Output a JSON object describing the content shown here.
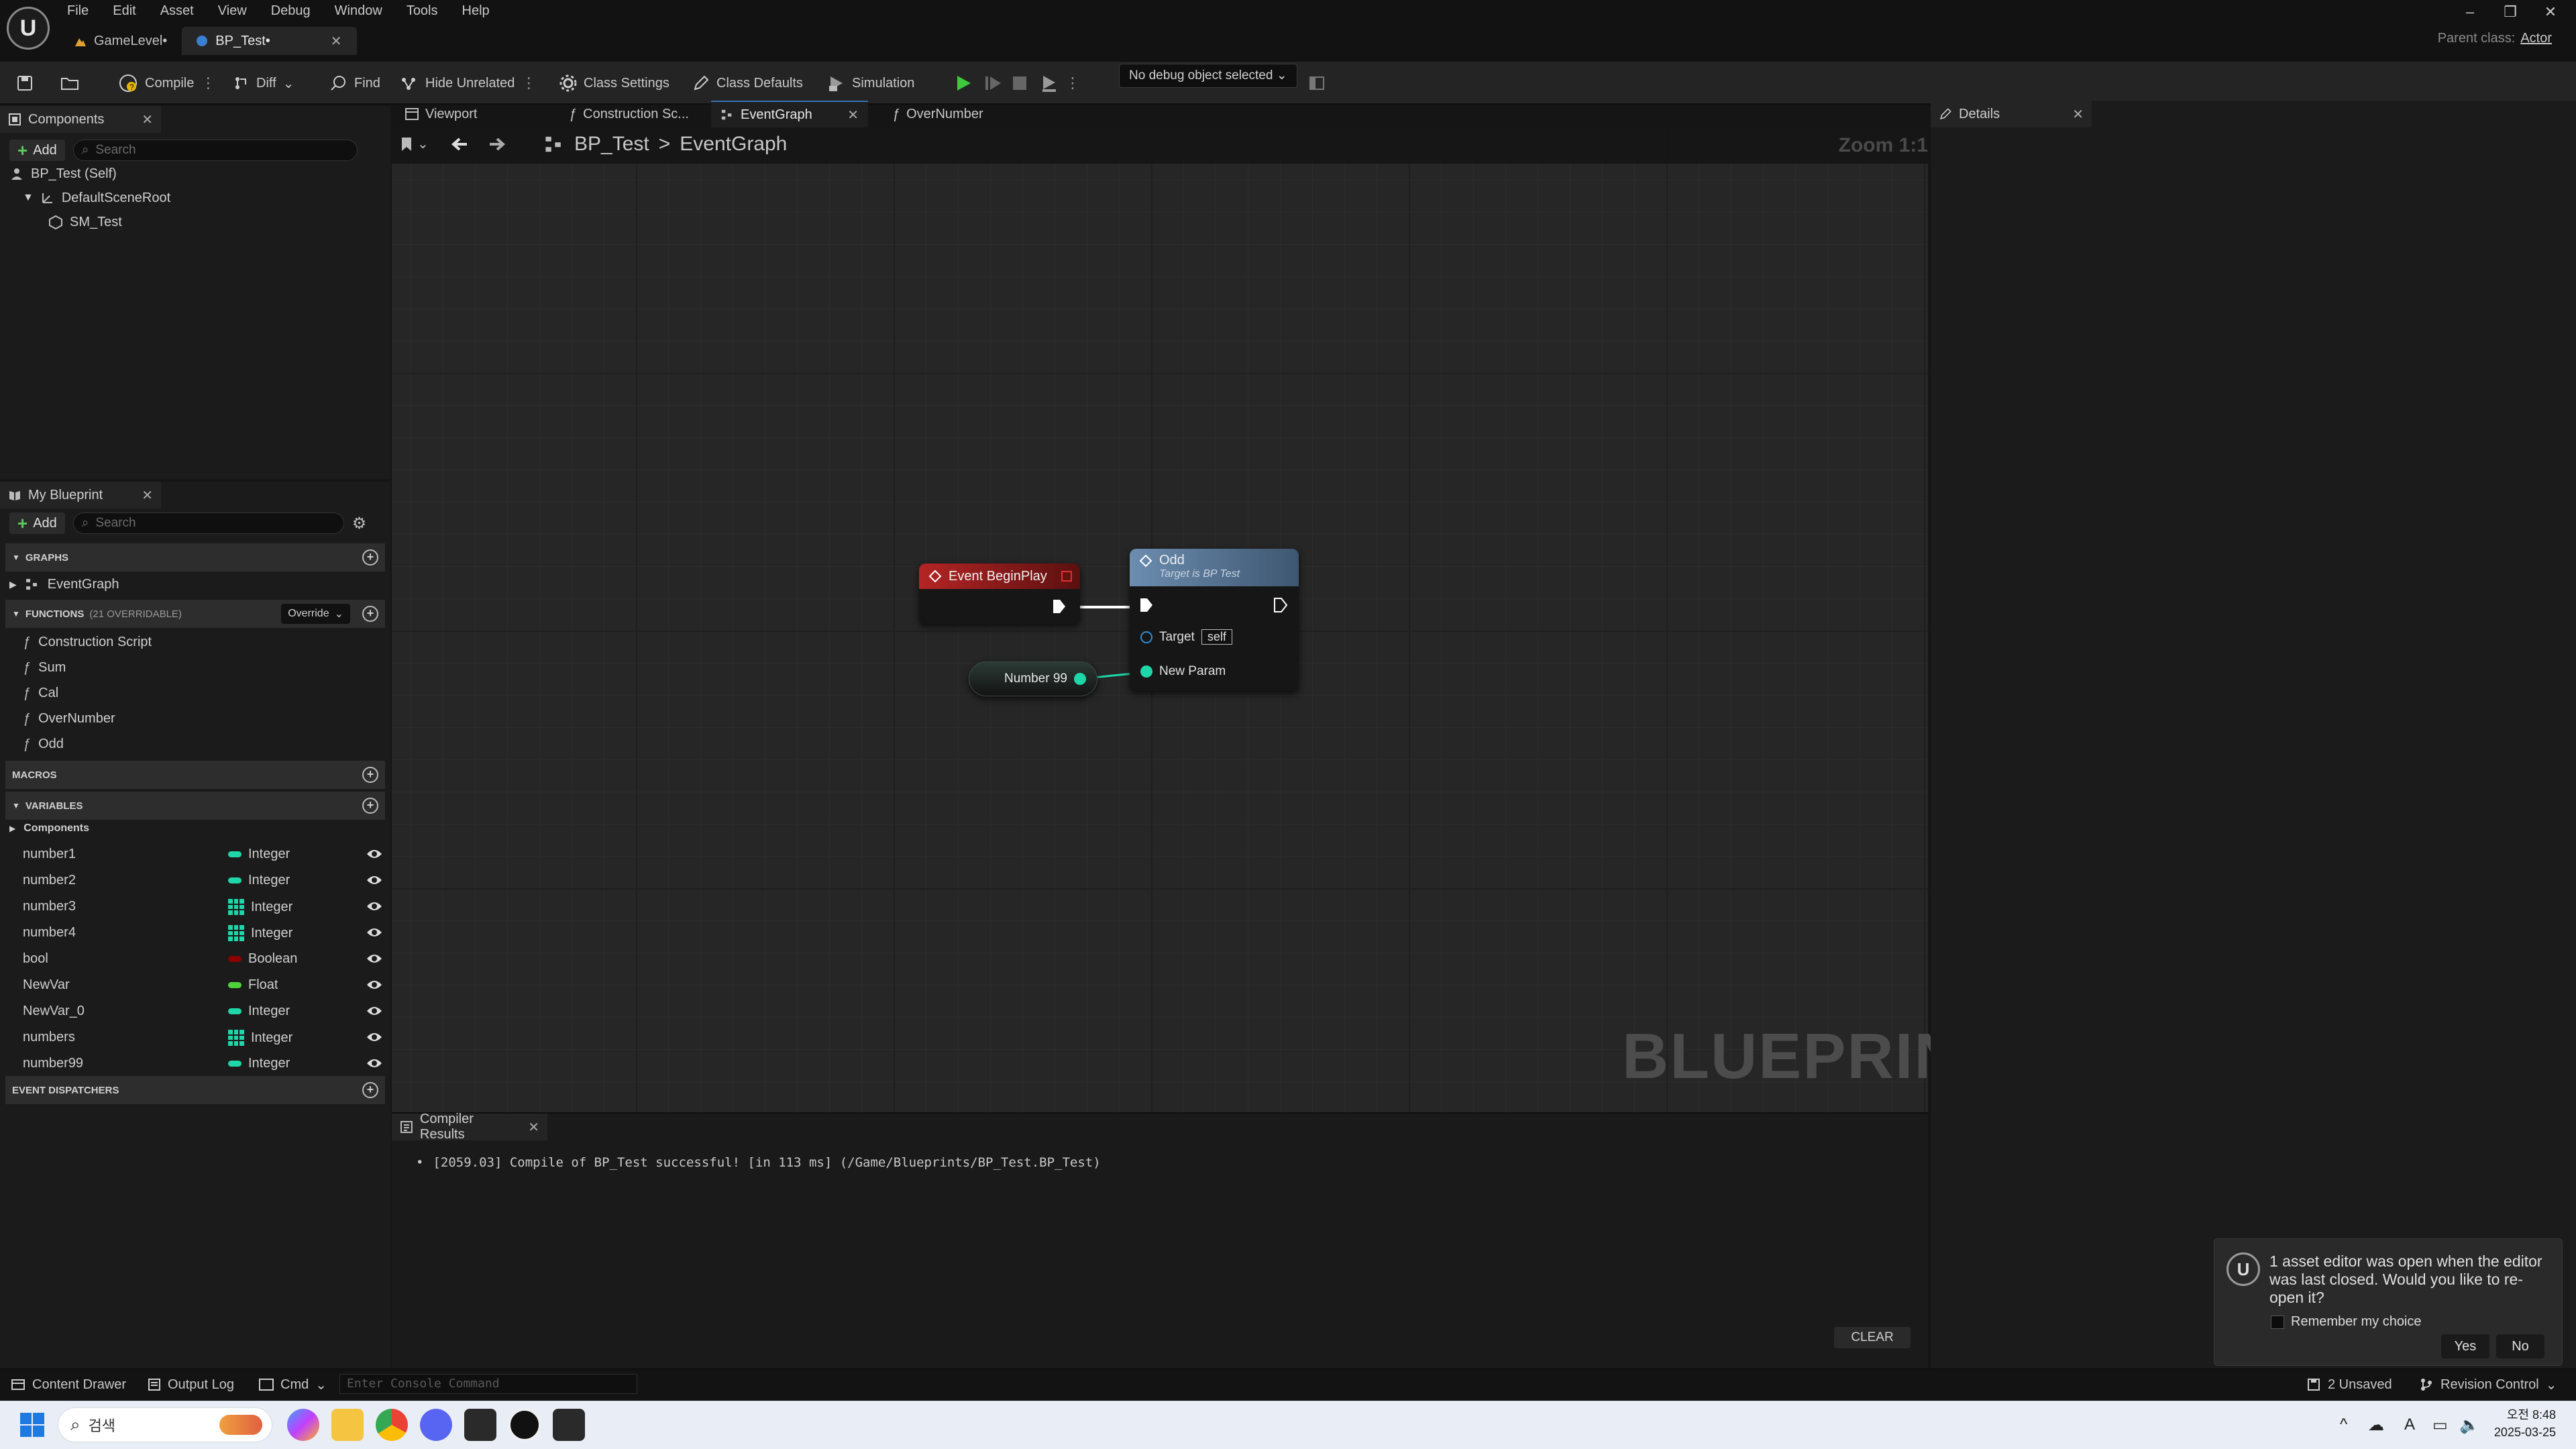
{
  "menu": [
    "File",
    "Edit",
    "Asset",
    "View",
    "Debug",
    "Window",
    "Tools",
    "Help"
  ],
  "doc_tabs": [
    {
      "label": "GameLevel•"
    },
    {
      "label": "BP_Test•"
    }
  ],
  "parent_class": {
    "label": "Parent class:",
    "value": "Actor"
  },
  "toolbar": {
    "compile": "Compile",
    "diff": "Diff",
    "find": "Find",
    "hide_unrelated": "Hide Unrelated",
    "class_settings": "Class Settings",
    "class_defaults": "Class Defaults",
    "simulation": "Simulation",
    "debug_object": "No debug object selected"
  },
  "components": {
    "title": "Components",
    "add": "Add",
    "search_placeholder": "Search",
    "tree": [
      "BP_Test (Self)",
      "DefaultSceneRoot",
      "SM_Test"
    ]
  },
  "my_blueprint": {
    "title": "My Blueprint",
    "add": "Add",
    "search_placeholder": "Search",
    "graphs_header": "GRAPHS",
    "graphs": [
      "EventGraph"
    ],
    "functions_header": "FUNCTIONS",
    "functions_count": "(21 OVERRIDABLE)",
    "override_label": "Override",
    "functions": [
      "Construction Script",
      "Sum",
      "Cal",
      "OverNumber",
      "Odd"
    ],
    "macros_header": "MACROS",
    "variables_header": "VARIABLES",
    "components_category": "Components",
    "variables": [
      {
        "name": "number1",
        "type": "Integer",
        "array": false,
        "color": "#1ed6a8"
      },
      {
        "name": "number2",
        "type": "Integer",
        "array": false,
        "color": "#1ed6a8"
      },
      {
        "name": "number3",
        "type": "Integer",
        "array": true,
        "color": "#1ed6a8"
      },
      {
        "name": "number4",
        "type": "Integer",
        "array": true,
        "color": "#1ed6a8"
      },
      {
        "name": "bool",
        "type": "Boolean",
        "array": false,
        "color": "#8c0000"
      },
      {
        "name": "NewVar",
        "type": "Float",
        "array": false,
        "color": "#4fd33a"
      },
      {
        "name": "NewVar_0",
        "type": "Integer",
        "array": false,
        "color": "#1ed6a8"
      },
      {
        "name": "numbers",
        "type": "Integer",
        "array": true,
        "color": "#1ed6a8"
      },
      {
        "name": "number99",
        "type": "Integer",
        "array": false,
        "color": "#1ed6a8"
      }
    ],
    "dispatchers_header": "EVENT DISPATCHERS"
  },
  "editor_tabs": [
    "Viewport",
    "Construction Sc...",
    "EventGraph",
    "OverNumber"
  ],
  "breadcrumb": {
    "root": "BP_Test",
    "separator": ">",
    "current": "EventGraph"
  },
  "zoom": "Zoom 1:1",
  "watermark": "BLUEPRINT",
  "nodes": {
    "begin_play": "Event BeginPlay",
    "odd_title": "Odd",
    "odd_subtitle": "Target is BP Test",
    "target_label": "Target",
    "target_value": "self",
    "new_param": "New Param",
    "number_var": "Number 99"
  },
  "details": {
    "title": "Details"
  },
  "compiler": {
    "title": "Compiler Results",
    "message": "[2059.03] Compile of BP_Test successful! [in 113 ms] (/Game/Blueprints/BP_Test.BP_Test)",
    "clear": "CLEAR"
  },
  "toast": {
    "message": "1 asset editor was open when the editor was last closed. Would you like to re-open it?",
    "remember": "Remember my choice",
    "yes": "Yes",
    "no": "No"
  },
  "statusbar": {
    "content_drawer": "Content Drawer",
    "output_log": "Output Log",
    "cmd": "Cmd",
    "console_placeholder": "Enter Console Command",
    "unsaved": "2 Unsaved",
    "revision_control": "Revision Control"
  },
  "taskbar": {
    "search": "검색",
    "time": "오전 8:48",
    "date": "2025-03-25"
  },
  "colors": {
    "exec": "#ffffff",
    "event_header": "#9b1c1c",
    "function_header": "#5a7c9c",
    "integer_pin": "#1ed6a8",
    "object_pin": "#2f8fd8",
    "accent": "#3a6fb0"
  }
}
